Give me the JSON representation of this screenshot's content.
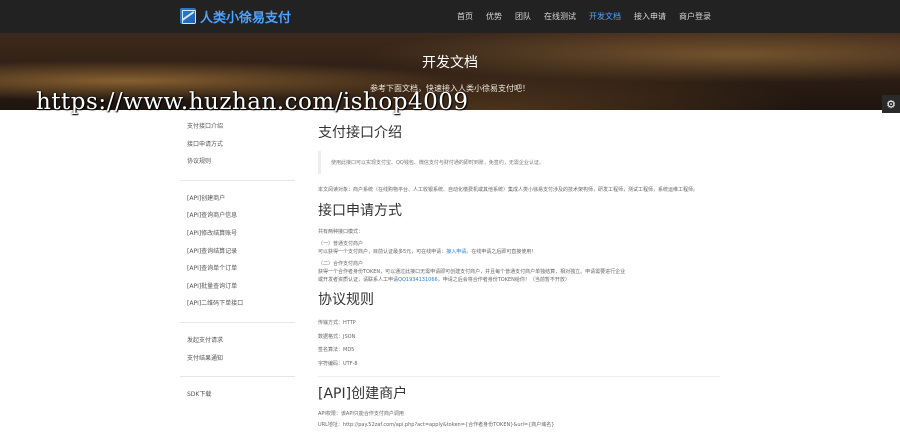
{
  "header": {
    "brand": "人类小徐易支付",
    "logo_icon": "pay-logo-icon",
    "nav": [
      {
        "label": "首页",
        "active": false
      },
      {
        "label": "优势",
        "active": false
      },
      {
        "label": "团队",
        "active": false
      },
      {
        "label": "在线测试",
        "active": false
      },
      {
        "label": "开发文档",
        "active": true
      },
      {
        "label": "接入申请",
        "active": false
      },
      {
        "label": "商户登录",
        "active": false
      }
    ],
    "accent_color": "#4da3ff"
  },
  "hero": {
    "title": "开发文档",
    "subtitle": "参考下面文档，快速接入人类小徐易支付吧！",
    "watermark": "https://www.huzhan.com/ishop4009"
  },
  "settings_icon": "gear-icon",
  "sidebar": {
    "group1": [
      "支付接口介绍",
      "接口申请方式",
      "协议规则"
    ],
    "group2": [
      "[API]创建商户",
      "[API]查询商户信息",
      "[API]修改结算账号",
      "[API]查询结算记录",
      "[API]查询单个订单",
      "[API]批量查询订单",
      "[API]二维码下单接口"
    ],
    "group3": [
      "发起支付请求",
      "支付结果通知"
    ],
    "group4": [
      "SDK下载"
    ]
  },
  "content": {
    "section1": {
      "title": "支付接口介绍",
      "quote": "使用此接口可以实现支付宝、QQ钱包、微信支付与财付通的即时到账，免签约，无需企业认证。",
      "para": "本文阅读对象：商户系统（在线购物平台、人工收银系统、自动化缴费机或其他系统）集成人类小徐易支付涉及的技术架构师，研发工程师，测试工程师，系统运维工程师。"
    },
    "section2": {
      "title": "接口申请方式",
      "intro": "共有两种接口模式：",
      "mode1_title": "（一）普通支付商户",
      "mode1_text": "可以获得一个支付商户，目前认证最多5元，可在线申请：",
      "mode1_link": "接入申请",
      "mode1_after": "。在线申请之后即可直接使用！",
      "mode2_title": "（二）合作支付商户",
      "mode2_text_1": "获得一个合作者身份TOKEN，可以通过此接口无需申请即可创建支付商户，并且每个普通支付商户单独结算，相对独立。申请需要进行企业",
      "mode2_text_2_a": "或开发者资质认证，请联系人工申请",
      "mode2_link": "QQ1934131066",
      "mode2_text_2_b": "，申请之后会将合作者身份TOKEN给你！（当前暂不开放）"
    },
    "section3": {
      "title": "协议规则",
      "rules": [
        "传输方式：HTTP",
        "数据格式：JSON",
        "签名算法：MD5",
        "字符编码：UTF-8"
      ]
    },
    "section4": {
      "title": "[API]创建商户",
      "line1": "API权限：该API只能合作支付商户调用",
      "line2": "URL地址：http://pay.52zaf.com/api.php?act=apply&token={合作者身份TOKEN}&url={商户域名}"
    }
  }
}
